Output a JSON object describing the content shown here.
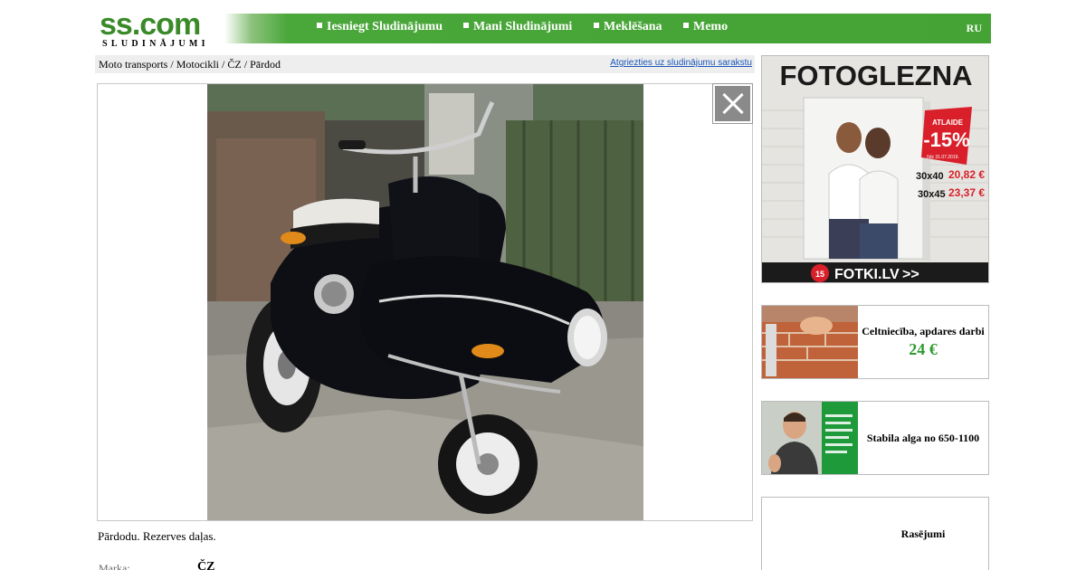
{
  "header": {
    "logo_main": "ss.com",
    "logo_sub": "SLUDINĀJUMI",
    "nav": [
      {
        "label": "Iesniegt Sludinājumu"
      },
      {
        "label": "Mani Sludinājumi"
      },
      {
        "label": "Meklēšana"
      },
      {
        "label": "Memo"
      }
    ],
    "lang": "RU"
  },
  "breadcrumb": {
    "items": [
      "Moto transports",
      "Motocikli",
      "ČZ",
      "Pārdod"
    ],
    "separator": " / ",
    "back_link": "Atgriezties uz sludinājumu sarakstu"
  },
  "listing": {
    "description": "Pārdodu. Rezerves daļas.",
    "params": [
      {
        "label": "Marka:",
        "value": "ČZ"
      }
    ]
  },
  "sidebar": {
    "banner": {
      "headline": "FOTOGLEZNA",
      "discount_label": "ATLAIDE",
      "discount": "-15%",
      "until": "līdz 31.07.2019.",
      "prices": [
        {
          "size": "30x40",
          "price": "20,82 €"
        },
        {
          "size": "30x45",
          "price": "23,37 €"
        }
      ],
      "brand": "FOTKI.LV",
      "brand_arrows": ">>"
    },
    "cards": [
      {
        "title": "Celtniecība, apdares darbi",
        "price": "24 €"
      },
      {
        "title": "Stabila alga no 650-1100",
        "price": ""
      },
      {
        "title": "Rasējumi",
        "price": ""
      }
    ]
  },
  "colors": {
    "brand_green": "#44a334",
    "price_green": "#2d9a2d",
    "link_blue": "#1a56b8",
    "banner_red": "#d9202a"
  }
}
